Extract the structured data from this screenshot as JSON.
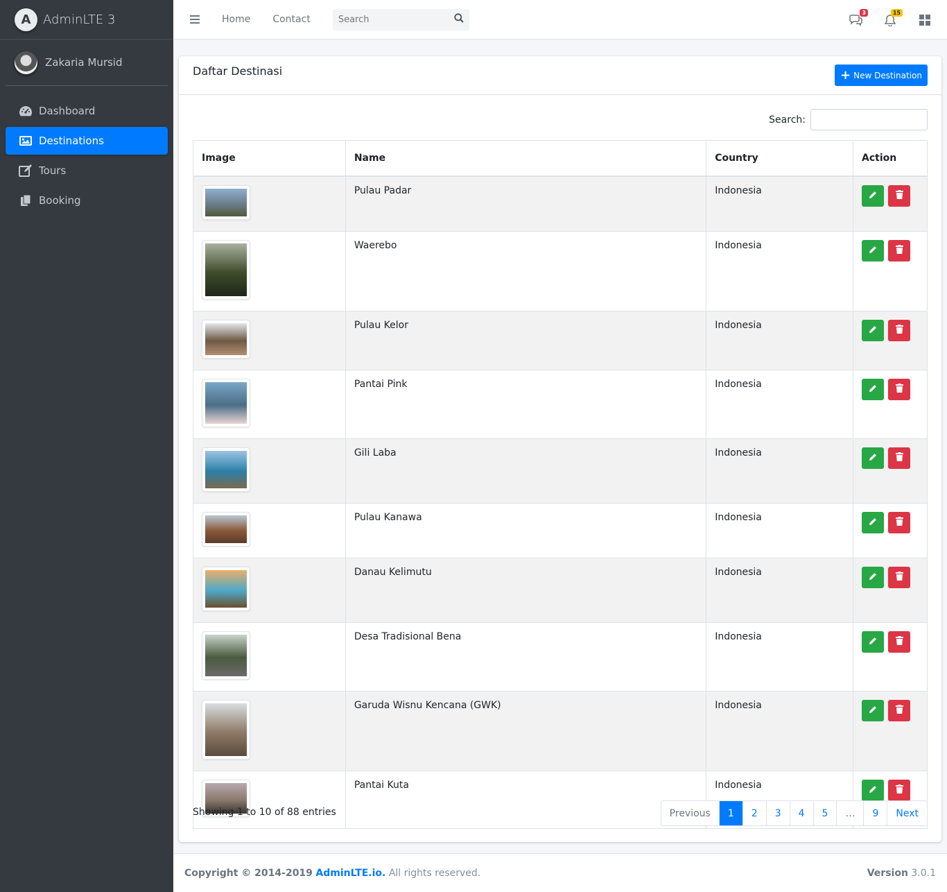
{
  "brand": {
    "title": "AdminLTE 3",
    "logo_letter": "A"
  },
  "user": {
    "name": "Zakaria Mursid"
  },
  "sidebar": {
    "items": [
      {
        "label": "Dashboard",
        "icon": "tachometer-icon",
        "active": false
      },
      {
        "label": "Destinations",
        "icon": "image-icon",
        "active": true
      },
      {
        "label": "Tours",
        "icon": "edit-icon",
        "active": false
      },
      {
        "label": "Booking",
        "icon": "copy-icon",
        "active": false
      }
    ]
  },
  "navbar": {
    "home": "Home",
    "contact": "Contact",
    "search_placeholder": "Search",
    "messages_count": "3",
    "notifications_count": "15"
  },
  "card": {
    "title": "Daftar Destinasi",
    "new_button": "New Destination",
    "search_label": "Search:"
  },
  "table": {
    "headers": [
      "Image",
      "Name",
      "Country",
      "Action"
    ],
    "rows": [
      {
        "name": "Pulau Padar",
        "country": "Indonesia",
        "thumb": "landscape",
        "colors": [
          "#8fb0cf",
          "#6d7d8a",
          "#4f5b3a"
        ]
      },
      {
        "name": "Waerebo",
        "country": "Indonesia",
        "thumb": "portrait",
        "colors": [
          "#a9b0a0",
          "#3f4d2c",
          "#1e2618"
        ]
      },
      {
        "name": "Pulau Kelor",
        "country": "Indonesia",
        "thumb": "square",
        "colors": [
          "#e3e6ea",
          "#6e5a44",
          "#b38e72"
        ]
      },
      {
        "name": "Pantai Pink",
        "country": "Indonesia",
        "thumb": "tall",
        "colors": [
          "#7aa6c9",
          "#4b6e86",
          "#e9d5d2"
        ]
      },
      {
        "name": "Gili Laba",
        "country": "Indonesia",
        "thumb": "landscape2",
        "colors": [
          "#9bc4e2",
          "#2c7fa8",
          "#7a6a4e"
        ]
      },
      {
        "name": "Pulau Kanawa",
        "country": "Indonesia",
        "thumb": "short",
        "colors": [
          "#b9c7d2",
          "#8a5a3a",
          "#5c3a2a"
        ]
      },
      {
        "name": "Danau Kelimutu",
        "country": "Indonesia",
        "thumb": "landscape2",
        "colors": [
          "#e8b06a",
          "#4fa8c8",
          "#6a5030"
        ]
      },
      {
        "name": "Desa Tradisional Bena",
        "country": "Indonesia",
        "thumb": "square2",
        "colors": [
          "#c7d4c9",
          "#4a5a40",
          "#6a6a6a"
        ]
      },
      {
        "name": "Garuda Wisnu Kencana (GWK)",
        "country": "Indonesia",
        "thumb": "portrait",
        "colors": [
          "#d8dde0",
          "#8f7a66",
          "#5b4b3d"
        ]
      },
      {
        "name": "Pantai Kuta",
        "country": "Indonesia",
        "thumb": "short2",
        "colors": [
          "#b7a9ad",
          "#8b7a6e",
          "#3a3530"
        ]
      }
    ]
  },
  "pagination": {
    "info": "Showing 1 to 10 of 88 entries",
    "previous": "Previous",
    "pages": [
      "1",
      "2",
      "3",
      "4",
      "5",
      "…",
      "9"
    ],
    "next": "Next",
    "current": "1"
  },
  "footer": {
    "copyright_prefix": "Copyright © 2014-2019",
    "copyright_link": "AdminLTE.io.",
    "copyright_suffix": "All rights reserved.",
    "version_label": "Version",
    "version_value": "3.0.1"
  },
  "colors": {
    "accent": "#007bff",
    "sidebar_bg": "#343a40",
    "edit": "#28a745",
    "delete": "#dc3545"
  }
}
